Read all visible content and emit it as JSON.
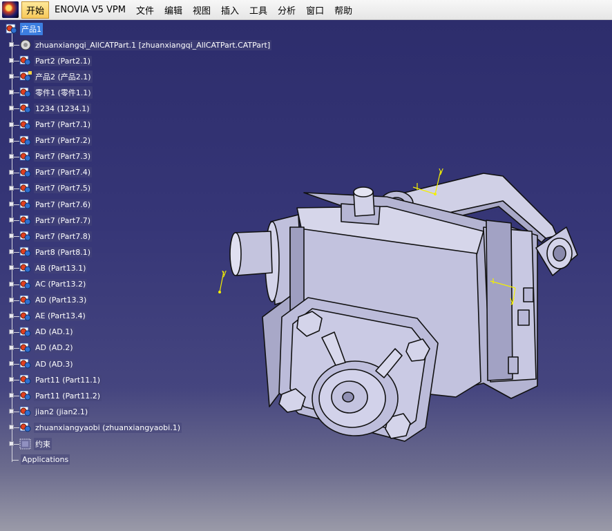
{
  "menubar": {
    "items": [
      "开始",
      "ENOVIA V5 VPM",
      "文件",
      "编辑",
      "视图",
      "插入",
      "工具",
      "分析",
      "窗口",
      "帮助"
    ]
  },
  "tree": {
    "root": "产品1",
    "nodes": [
      {
        "label": "zhuanxiangqi_AllCATPart.1 [zhuanxiangqi_AllCATPart.CATPart]",
        "icon": "part-body-icon"
      },
      {
        "label": "Part2 (Part2.1)",
        "icon": "part-gear-icon"
      },
      {
        "label": "产品2 (产品2.1)",
        "icon": "product-gear-icon"
      },
      {
        "label": "零件1 (零件1.1)",
        "icon": "part-gear-icon"
      },
      {
        "label": "1234 (1234.1)",
        "icon": "part-gear-icon"
      },
      {
        "label": "Part7 (Part7.1)",
        "icon": "part-gear-icon"
      },
      {
        "label": "Part7 (Part7.2)",
        "icon": "part-gear-icon"
      },
      {
        "label": "Part7 (Part7.3)",
        "icon": "part-gear-icon"
      },
      {
        "label": "Part7 (Part7.4)",
        "icon": "part-gear-icon"
      },
      {
        "label": "Part7 (Part7.5)",
        "icon": "part-gear-icon"
      },
      {
        "label": "Part7 (Part7.6)",
        "icon": "part-gear-icon"
      },
      {
        "label": "Part7 (Part7.7)",
        "icon": "part-gear-icon"
      },
      {
        "label": "Part7 (Part7.8)",
        "icon": "part-gear-icon"
      },
      {
        "label": "Part8 (Part8.1)",
        "icon": "part-gear-icon"
      },
      {
        "label": "AB (Part13.1)",
        "icon": "part-gear-icon"
      },
      {
        "label": "AC (Part13.2)",
        "icon": "part-gear-icon"
      },
      {
        "label": "AD (Part13.3)",
        "icon": "part-gear-icon"
      },
      {
        "label": "AE (Part13.4)",
        "icon": "part-gear-icon"
      },
      {
        "label": "AD (AD.1)",
        "icon": "part-gear-icon"
      },
      {
        "label": "AD (AD.2)",
        "icon": "part-gear-icon"
      },
      {
        "label": "AD (AD.3)",
        "icon": "part-gear-icon"
      },
      {
        "label": "Part11 (Part11.1)",
        "icon": "part-gear-icon"
      },
      {
        "label": "Part11 (Part11.2)",
        "icon": "part-gear-icon"
      },
      {
        "label": "jian2 (jian2.1)",
        "icon": "part-gear-icon"
      },
      {
        "label": "zhuanxiangyaobi (zhuanxiangyaobi.1)",
        "icon": "part-gear-icon"
      },
      {
        "label": "约束",
        "icon": "constraints-icon"
      }
    ],
    "applications": "Applications"
  },
  "viewport": {
    "axis_label": "y",
    "background_top": "#2d2d6c",
    "model_color": "#c6c6e0"
  }
}
